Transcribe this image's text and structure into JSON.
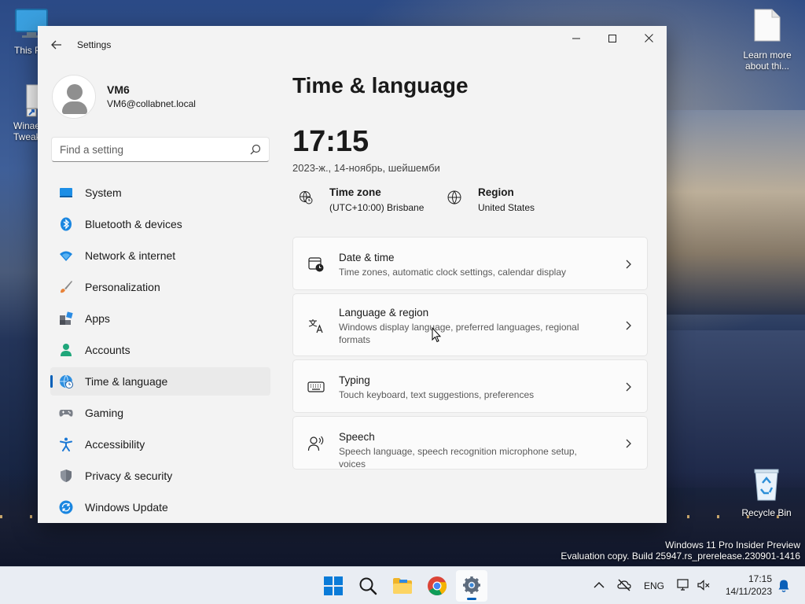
{
  "desktop": {
    "icons": [
      {
        "label": "This P"
      },
      {
        "label_line1": "Winae",
        "label_line2": "Tweak"
      },
      {
        "label_line1": "Learn more",
        "label_line2": "about thi..."
      },
      {
        "label": "Recycle Bin"
      }
    ],
    "watermark_line1": "Windows 11 Pro Insider Preview",
    "watermark_line2": "Evaluation copy. Build 25947.rs_prerelease.230901-1416"
  },
  "window": {
    "title": "Settings",
    "back_icon": "back-arrow-icon",
    "controls": [
      "minimize",
      "maximize",
      "close"
    ]
  },
  "profile": {
    "name": "VM6",
    "email": "VM6@collabnet.local"
  },
  "search": {
    "placeholder": "Find a setting"
  },
  "nav": {
    "items": [
      {
        "label": "System",
        "icon": "monitor-icon",
        "active": false
      },
      {
        "label": "Bluetooth & devices",
        "icon": "bluetooth-icon",
        "active": false
      },
      {
        "label": "Network & internet",
        "icon": "wifi-icon",
        "active": false
      },
      {
        "label": "Personalization",
        "icon": "brush-icon",
        "active": false
      },
      {
        "label": "Apps",
        "icon": "apps-icon",
        "active": false
      },
      {
        "label": "Accounts",
        "icon": "person-icon",
        "active": false
      },
      {
        "label": "Time & language",
        "icon": "globe-clock-icon",
        "active": true
      },
      {
        "label": "Gaming",
        "icon": "gamepad-icon",
        "active": false
      },
      {
        "label": "Accessibility",
        "icon": "accessibility-icon",
        "active": false
      },
      {
        "label": "Privacy & security",
        "icon": "shield-icon",
        "active": false
      },
      {
        "label": "Windows Update",
        "icon": "update-icon",
        "active": false
      }
    ]
  },
  "main": {
    "title": "Time & language",
    "time": "17:15",
    "date": "2023-ж., 14-ноябрь, шейшемби",
    "timezone": {
      "title": "Time zone",
      "value": "(UTC+10:00) Brisbane"
    },
    "region": {
      "title": "Region",
      "value": "United States"
    },
    "cards": [
      {
        "title": "Date & time",
        "subtitle": "Time zones, automatic clock settings, calendar display",
        "icon": "calendar-clock-icon"
      },
      {
        "title": "Language & region",
        "subtitle": "Windows display language, preferred languages, regional formats",
        "icon": "language-icon"
      },
      {
        "title": "Typing",
        "subtitle": "Touch keyboard, text suggestions, preferences",
        "icon": "keyboard-icon"
      },
      {
        "title": "Speech",
        "subtitle": "Speech language, speech recognition microphone setup, voices",
        "icon": "speech-icon"
      }
    ]
  },
  "taskbar": {
    "apps": [
      "start-icon",
      "search-icon",
      "file-explorer-icon",
      "chrome-icon",
      "settings-icon"
    ],
    "language": "ENG",
    "time": "17:15",
    "date": "14/11/2023"
  },
  "colors": {
    "accent": "#005fb8",
    "window_bg": "#f3f3f3",
    "card_bg": "#fbfbfb"
  }
}
